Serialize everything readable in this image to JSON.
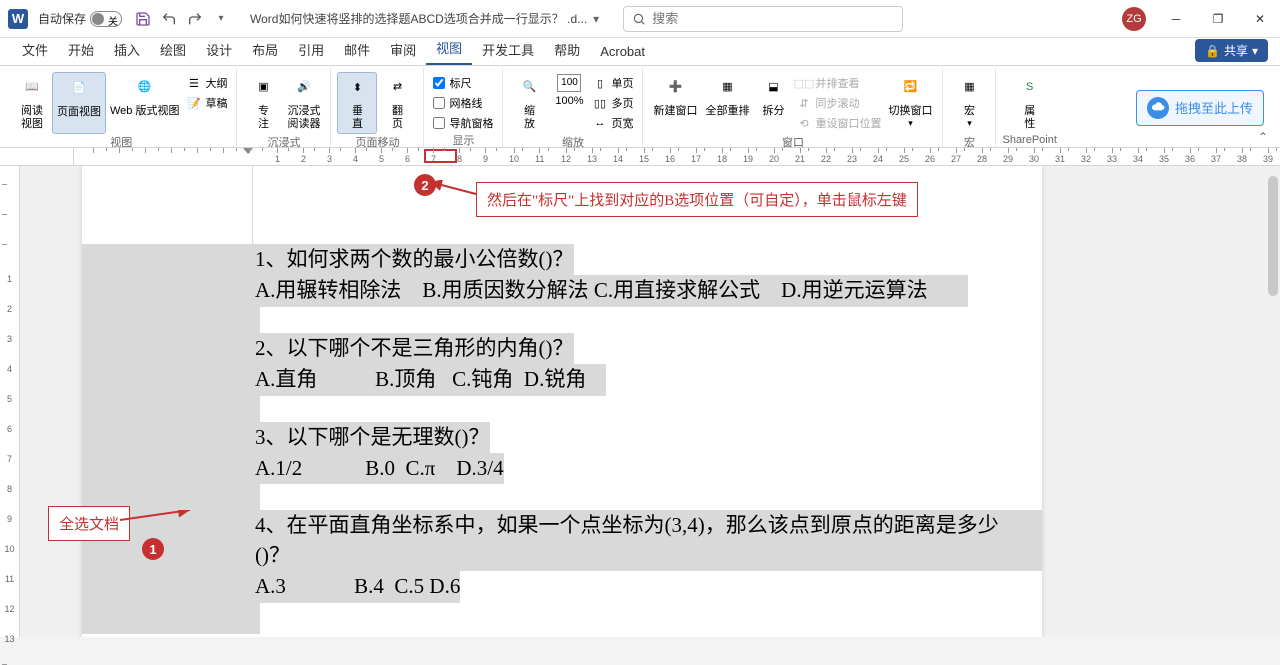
{
  "title_bar": {
    "autosave_label": "自动保存",
    "autosave_state": "关",
    "doc_title": "Word如何快速将竖排的选择题ABCD选项合并成一行显示？ .d...",
    "search_placeholder": "搜索",
    "user_initials": "ZG"
  },
  "tabs": [
    "文件",
    "开始",
    "插入",
    "绘图",
    "设计",
    "布局",
    "引用",
    "邮件",
    "审阅",
    "视图",
    "开发工具",
    "帮助",
    "Acrobat"
  ],
  "active_tab": "视图",
  "share_label": "共享",
  "ribbon": {
    "groups": {
      "views": {
        "label": "视图",
        "read": "阅读\n视图",
        "page": "页面视图",
        "web": "Web 版式视图",
        "outline": "大纲",
        "draft": "草稿"
      },
      "immersive": {
        "label": "沉浸式",
        "focus": "专\n注",
        "reader": "沉浸式\n阅读器"
      },
      "page_move": {
        "label": "页面移动",
        "vertical": "垂\n直",
        "flip": "翻\n页"
      },
      "show": {
        "label": "显示",
        "ruler": "标尺",
        "grid": "网格线",
        "nav": "导航窗格"
      },
      "zoom": {
        "label": "缩放",
        "zoom": "缩\n放",
        "hundred": "100%",
        "one_page": "单页",
        "multi_page": "多页",
        "page_width": "页宽"
      },
      "window": {
        "label": "窗口",
        "new": "新建窗口",
        "arrange": "全部重排",
        "split": "拆分",
        "side": "并排查看",
        "sync": "同步滚动",
        "reset": "重设窗口位置",
        "switch": "切换窗口"
      },
      "macro": {
        "label": "宏",
        "macro": "宏"
      },
      "sp": {
        "label": "SharePoint",
        "props": "属\n性"
      }
    },
    "upload": "拖拽至此上传"
  },
  "annotations": {
    "box1": "全选文档",
    "badge1": "1",
    "box2": "然后在\"标尺\"上找到对应的B选项位置（可自定），单击鼠标左键",
    "badge2": "2"
  },
  "document": {
    "q1": "1、如何求两个数的最小公倍数()？",
    "q1o": "A.用辗转相除法    B.用质因数分解法 C.用直接求解公式    D.用逆元运算法",
    "q2": "2、以下哪个不是三角形的内角()？",
    "q2o": "A.直角           B.顶角   C.钝角  D.锐角",
    "q3": "3、以下哪个是无理数()？",
    "q3o": "A.1/2            B.0  C.π    D.3/4",
    "q4": "4、在平面直角坐标系中，如果一个点坐标为(3,4)，那么该点到原点的距离是多少()？",
    "q4o": "A.3             B.4  C.5 D.6"
  },
  "ruler_numbers": [
    "1",
    "2",
    "3",
    "4",
    "5",
    "6",
    "7",
    "8",
    "9",
    "10",
    "11",
    "12",
    "13",
    "14",
    "15",
    "16",
    "17",
    "18",
    "19",
    "20",
    "21",
    "22",
    "23",
    "24",
    "25",
    "26",
    "27",
    "28",
    "29",
    "30",
    "31",
    "32",
    "33",
    "34",
    "35",
    "36",
    "37",
    "38",
    "39"
  ],
  "vruler_numbers": [
    "1",
    "2",
    "3",
    "4",
    "5",
    "6",
    "7",
    "8",
    "9",
    "10",
    "11",
    "12",
    "13"
  ]
}
